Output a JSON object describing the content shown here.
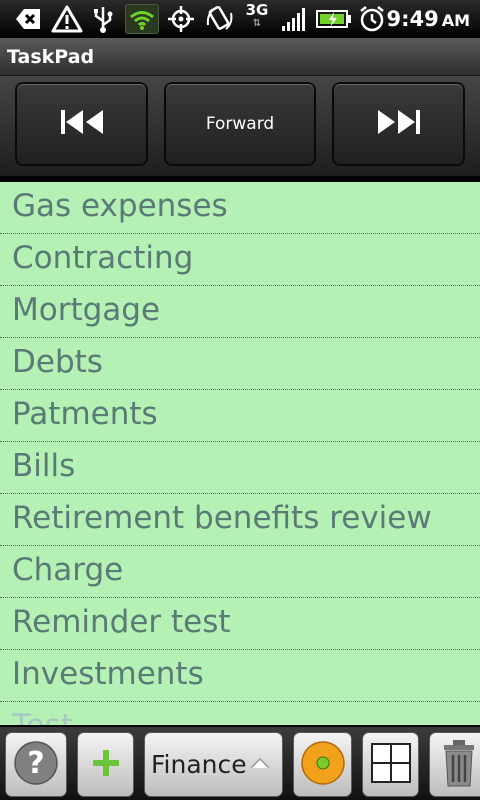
{
  "status_bar": {
    "time": "9:49",
    "ampm": "AM",
    "network": "3G"
  },
  "app": {
    "title": "TaskPad"
  },
  "nav": {
    "back_icon": "skip-back-icon",
    "forward_label": "Forward",
    "next_icon": "skip-forward-icon"
  },
  "tasks": [
    "Gas expenses",
    "Contracting",
    "Mortgage",
    "Debts",
    "Patments",
    "Bills",
    "Retirement benefits review",
    "Charge",
    "Reminder test",
    "Investments",
    "Test"
  ],
  "toolbar": {
    "help_icon": "help-icon",
    "add_icon": "plus-icon",
    "category_selected": "Finance",
    "record_icon": "record-icon",
    "grid_icon": "grid-icon",
    "trash_icon": "trash-icon"
  },
  "colors": {
    "list_background": "#b5f0b5",
    "list_text": "#5a7a76",
    "add_green": "#6cc43a",
    "record_orange": "#f2a21a",
    "record_green": "#7bcc2b"
  }
}
